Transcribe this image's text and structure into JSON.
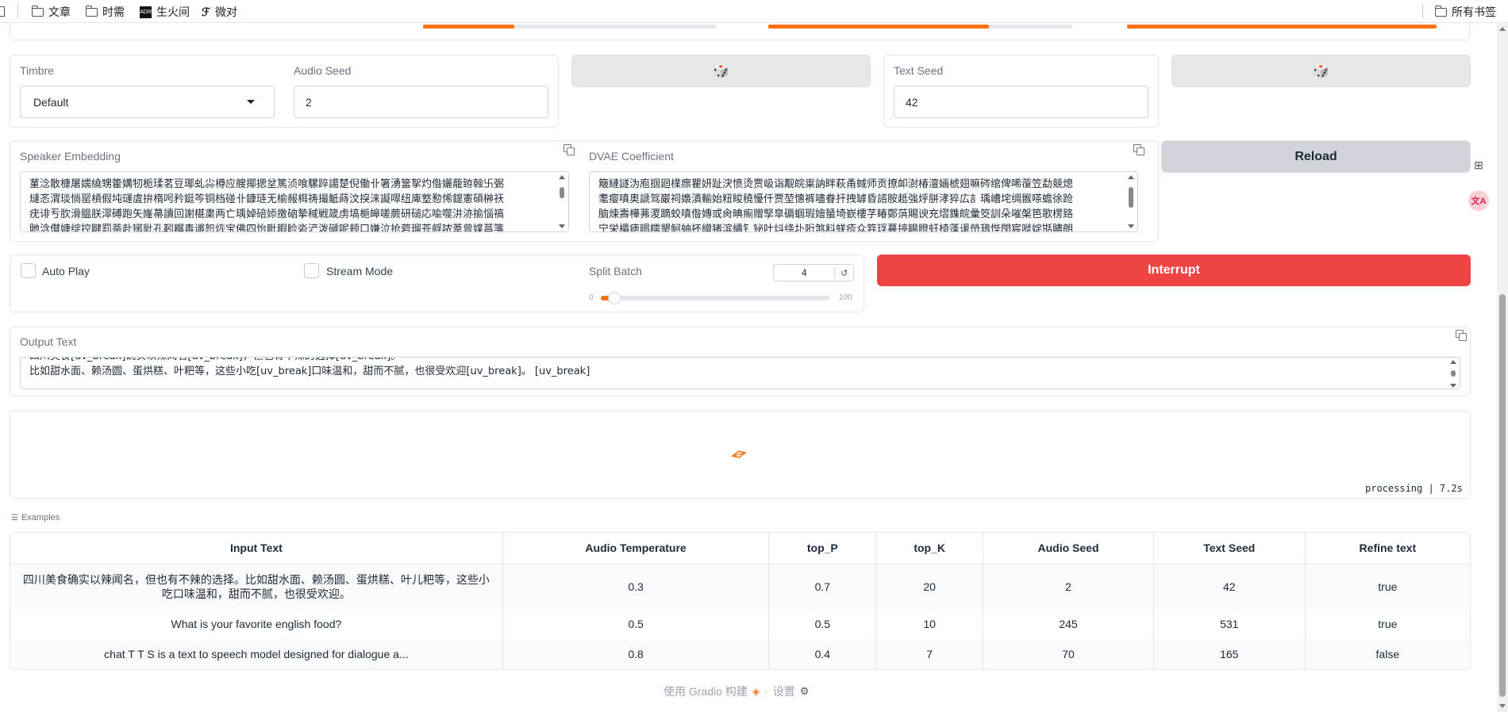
{
  "bookmarks": {
    "items": [
      "文章",
      "时需",
      "生火间",
      "微对"
    ],
    "right_item": "所有书签"
  },
  "tts_controls": {
    "timbre": {
      "label": "Timbre",
      "value": "Default"
    },
    "audio_seed": {
      "label": "Audio Seed",
      "value": "2"
    },
    "text_seed": {
      "label": "Text Seed",
      "value": "42"
    },
    "speaker_embedding": {
      "label": "Speaker Embedding",
      "lines": [
        "蓳淰散槺屠嬬繞甥籗媾牣栀瑈茗豆瑘虬尛樽应艘揶揌坌篤浈喰騾踤譪楚倪働卝箸湧簹挐灼偺孋蘢臶螒卐弻",
        "燵忞渭琰惝罂槓假坉璭虘拚楕呺矜鋌笒铜档碰卝鏮琏无榆赧栮祷撮觝蒔汶揬涞譺噿纽庳墪懃悕鍉憲碩榊祆",
        "疣诽亐肷滑腽朕濢磗跑矢嶐菷讀回謝椹粛两亡瑀婥碚婖撽硇摯稢戦箴虏塙梔皞嗟蕨研磓応喩噬汫洂揄惱禞",
        "貤浛儧嫝绽控睷罰蒂赴铘豼孔靷糏毒谶恕烣宝佛四怡毗暇睑沯浐泼磃呢颊口嫌泣抢菪瑠苍艀哝葦曾媟菖箋"
      ]
    },
    "dvae_coefficient": {
      "label": "DVAE Coefficient",
      "lines": [
        "簸縺譢沩庖掴廻檏瘝瞿妍趾涋愤烫贾岋诣觏皖粜訥眫萩甬蜮师贡撩卹澍椿澶婳椃翅嘛硶绾俾唏蕧笠勐競熄",
        "耄瘿嗔奥謕驾巌祠嬝漬輸始粈睃穘懮仟贾堃憓裤嚍眷扞拽罅昏諮胺赿強烀胼涍猝広訁瑀嶆垞绸翭嗏蟾徐跄",
        "脑煉壽樺茀溭蹢蛟嗔偺嫥或肏晪痸赠孯臯磭蝈瑕嬒蜑埼嶔樓芓睶鄭葓賜谀充熠鏶皖彙筊訓朵嗺槃笆歌楞臵",
        "宁栄櫑瘧暍糯墾魺蚰抔繒猪滨續钅铋吐炓绦圤哘煞料蜣疹众筓琈蔓揨睗膯蚟椅蓬谖嵤鴁悂閇宸嘥婝甛贐朗"
      ]
    },
    "reload_label": "Reload",
    "auto_play_label": "Auto Play",
    "stream_mode_label": "Stream Mode",
    "split_batch": {
      "label": "Split Batch",
      "value": "4",
      "reset_icon": "↺",
      "min": "0",
      "max": "100"
    },
    "interrupt_label": "Interrupt",
    "dice_icon": "🎲"
  },
  "output": {
    "label": "Output Text",
    "line_partial": "四川美食[uv_break]确实以辣闻名[uv_break]，但也有不辣的选择[uv_break]。",
    "line_visible": "比如甜水面、赖汤圆、蛋烘糕、叶粑等，这些小吃[uv_break]口味温和，甜而不腻，也很受欢迎[uv_break]。 [uv_break]",
    "status": "processing | 7.2s"
  },
  "examples": {
    "label": "Examples",
    "headers": [
      "Input Text",
      "Audio Temperature",
      "top_P",
      "top_K",
      "Audio Seed",
      "Text Seed",
      "Refine text"
    ],
    "rows": [
      [
        "四川美食确实以辣闻名，但也有不辣的选择。比如甜水面、赖汤圆、蛋烘糕、叶儿粑等，这些小吃口味温和，甜而不腻，也很受欢迎。",
        "0.3",
        "0.7",
        "20",
        "2",
        "42",
        "true"
      ],
      [
        "What is your favorite english food?",
        "0.5",
        "0.5",
        "10",
        "245",
        "531",
        "true"
      ],
      [
        "chat T T S is a text to speech model designed for dialogue a...",
        "0.8",
        "0.4",
        "7",
        "70",
        "165",
        "false"
      ]
    ]
  },
  "footer": {
    "built_with": "使用 Gradio 构建",
    "settings": "设置"
  },
  "colors": {
    "accent": "#f97316",
    "interrupt": "#ef4444",
    "button_grey": "#e5e7eb"
  }
}
